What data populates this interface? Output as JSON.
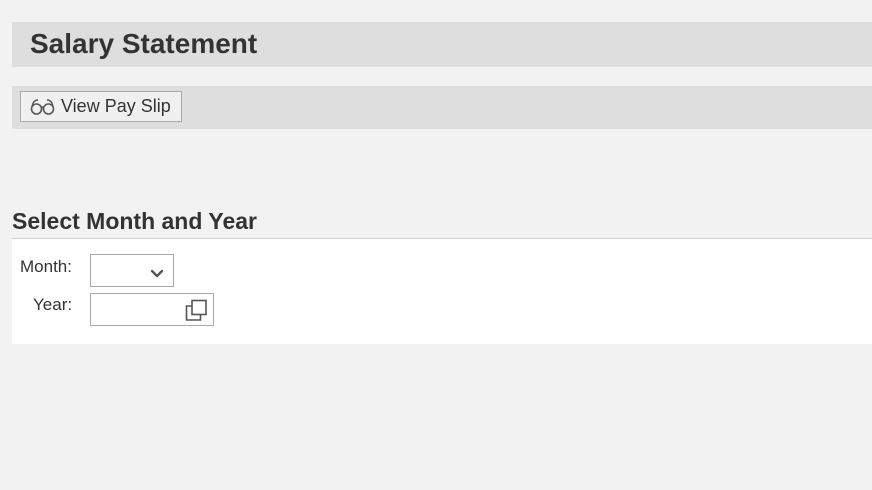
{
  "header": {
    "title": "Salary Statement"
  },
  "toolbar": {
    "view_pay_slip": {
      "label": "View Pay Slip",
      "icon": "glasses-icon"
    }
  },
  "section": {
    "title": "Select Month and Year"
  },
  "form": {
    "month": {
      "label": "Month:",
      "value": "",
      "icon": "chevron-down-icon"
    },
    "year": {
      "label": "Year:",
      "value": "",
      "placeholder": "",
      "icon": "value-help-icon"
    }
  },
  "colors": {
    "page_background": "#f2f2f2",
    "bar_background": "#dedede",
    "panel_background": "#ffffff",
    "text": "#333333",
    "border": "#a9a9a9"
  }
}
